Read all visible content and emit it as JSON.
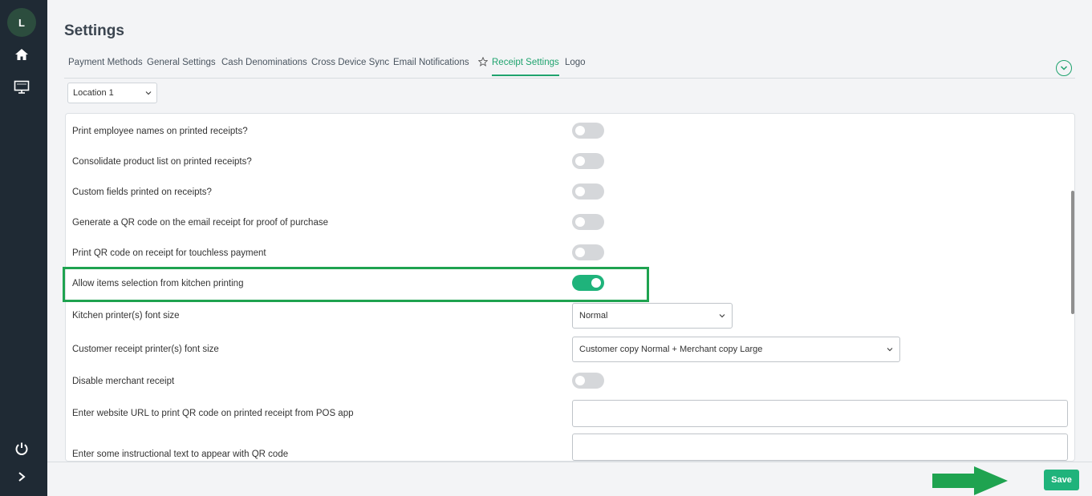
{
  "sidebar": {
    "avatar_initial": "L",
    "icons": [
      "home-icon",
      "monitor-icon",
      "power-icon",
      "chevron-right-icon"
    ],
    "background": "#1f2a34"
  },
  "header": {
    "title": "Settings",
    "tabs": [
      {
        "label": "Payment Methods",
        "active": false
      },
      {
        "label": "General Settings",
        "active": false
      },
      {
        "label": "Cash Denominations",
        "active": false
      },
      {
        "label": "Cross Device Sync",
        "active": false
      },
      {
        "label": "Email Notifications",
        "active": false
      },
      {
        "label": "Receipt Settings",
        "active": true
      },
      {
        "label": "Logo",
        "active": false
      }
    ]
  },
  "location_select": {
    "value": "Location 1"
  },
  "settings": [
    {
      "label": "Print employee names on printed receipts?",
      "type": "toggle",
      "on": false
    },
    {
      "label": "Consolidate product list on printed receipts?",
      "type": "toggle",
      "on": false
    },
    {
      "label": "Custom fields printed on receipts?",
      "type": "toggle",
      "on": false
    },
    {
      "label": "Generate a QR code on the email receipt for proof of purchase",
      "type": "toggle",
      "on": false
    },
    {
      "label": "Print QR code on receipt for touchless payment",
      "type": "toggle",
      "on": false
    },
    {
      "label": "Allow items selection from kitchen printing",
      "type": "toggle",
      "on": true
    },
    {
      "label": "Kitchen printer(s) font size",
      "type": "select",
      "value": "Normal"
    },
    {
      "label": "Customer receipt printer(s) font size",
      "type": "select",
      "value": "Customer copy Normal + Merchant copy Large"
    },
    {
      "label": "Disable merchant receipt",
      "type": "toggle",
      "on": false
    },
    {
      "label": "Enter website URL to print QR code on printed receipt from POS app",
      "type": "text",
      "value": ""
    },
    {
      "label": "Enter some instructional text to appear with QR code",
      "type": "text",
      "value": ""
    }
  ],
  "footer": {
    "save_label": "Save"
  },
  "colors": {
    "accent": "#1fb37b",
    "highlight": "#1fa350"
  }
}
